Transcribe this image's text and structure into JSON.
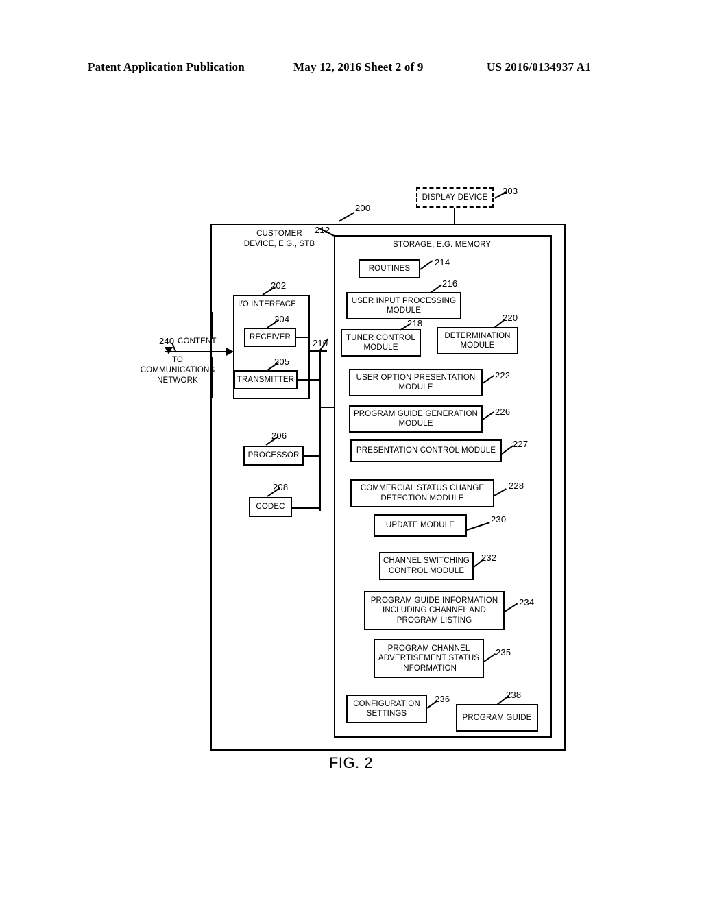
{
  "header": {
    "left": "Patent Application Publication",
    "center": "May 12, 2016  Sheet 2 of 9",
    "right": "US 2016/0134937 A1"
  },
  "figure": {
    "caption": "FIG. 2",
    "display_device": {
      "label": "DISPLAY DEVICE",
      "ref": "203"
    },
    "device": {
      "label_line1": "CUSTOMER",
      "label_line2": "DEVICE, E.G., STB",
      "ref": "200"
    },
    "bus": {
      "ref": "210"
    },
    "storage": {
      "label": "STORAGE, E.G. MEMORY",
      "ref": "212"
    },
    "io_interface": {
      "label": "I/O INTERFACE",
      "ref": "202"
    },
    "content_arrow": {
      "ref": "240",
      "label": "CONTENT",
      "to_line1": "TO",
      "to_line2": "COMMUNICATIONS",
      "to_line3": "NETWORK"
    },
    "io_children": [
      {
        "label": "RECEIVER",
        "ref": "204"
      },
      {
        "label": "TRANSMITTER",
        "ref": "205"
      }
    ],
    "device_blocks": [
      {
        "label": "PROCESSOR",
        "ref": "206"
      },
      {
        "label": "CODEC",
        "ref": "208"
      }
    ],
    "storage_blocks": [
      {
        "label": "ROUTINES",
        "ref": "214"
      },
      {
        "label": "USER INPUT PROCESSING MODULE",
        "ref": "216"
      },
      {
        "label": "TUNER CONTROL MODULE",
        "ref": "218"
      },
      {
        "label": "DETERMINATION MODULE",
        "ref": "220"
      },
      {
        "label": "USER OPTION PRESENTATION MODULE",
        "ref": "222"
      },
      {
        "label": "PROGRAM GUIDE GENERATION MODULE",
        "ref": "226"
      },
      {
        "label": "PRESENTATION CONTROL MODULE",
        "ref": "227"
      },
      {
        "label": "COMMERCIAL STATUS CHANGE DETECTION MODULE",
        "ref": "228"
      },
      {
        "label": "UPDATE MODULE",
        "ref": "230"
      },
      {
        "label": "CHANNEL SWITCHING CONTROL MODULE",
        "ref": "232"
      },
      {
        "label": "PROGRAM GUIDE INFORMATION INCLUDING  CHANNEL AND PROGRAM LISTING",
        "ref": "234"
      },
      {
        "label": "PROGRAM CHANNEL ADVERTISEMENT STATUS INFORMATION",
        "ref": "235"
      },
      {
        "label": "CONFIGURATION SETTINGS",
        "ref": "236"
      },
      {
        "label": "PROGRAM GUIDE",
        "ref": "238"
      }
    ]
  },
  "colors": {
    "ink": "#000000",
    "paper": "#ffffff"
  }
}
